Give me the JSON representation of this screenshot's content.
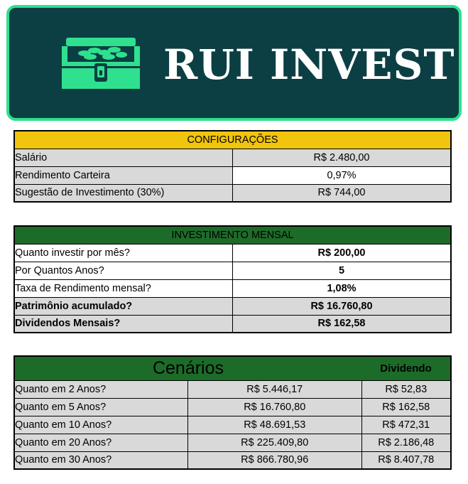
{
  "banner": {
    "title": "RUI INVEST",
    "logo_icon": "treasure-chest-icon",
    "background": "#0c3f43",
    "border_color": "#2fe08e",
    "logo_color": "#2fe08e"
  },
  "config": {
    "title": "CONFIGURAÇÕES",
    "header_color": "#f1c40e",
    "rows": [
      {
        "label": "Salário",
        "value": "R$ 2.480,00"
      },
      {
        "label": "Rendimento Carteira",
        "value": "0,97%"
      },
      {
        "label": "Sugestão de Investimento (30%)",
        "value": "R$ 744,00"
      }
    ]
  },
  "invest": {
    "title": "INVESTIMENTO MENSAL",
    "header_color": "#1d6b29",
    "rows": [
      {
        "label": "Quanto investir por mês?",
        "value": "R$ 200,00"
      },
      {
        "label": "Por Quantos Anos?",
        "value": "5"
      },
      {
        "label": "Taxa de Rendimento mensal?",
        "value": "1,08%"
      },
      {
        "label": "Patrimônio acumulado?",
        "value": "R$ 16.760,80"
      },
      {
        "label": "Dividendos Mensais?",
        "value": "R$ 162,58"
      }
    ]
  },
  "cenarios": {
    "title": "Cenários",
    "dividend_header": "Dividendo",
    "rows": [
      {
        "label": "Quanto em 2 Anos?",
        "value": "R$ 5.446,17",
        "dividend": "R$ 52,83"
      },
      {
        "label": "Quanto em 5 Anos?",
        "value": "R$ 16.760,80",
        "dividend": "R$ 162,58"
      },
      {
        "label": "Quanto em 10 Anos?",
        "value": "R$ 48.691,53",
        "dividend": "R$ 472,31"
      },
      {
        "label": "Quanto em 20 Anos?",
        "value": "R$ 225.409,80",
        "dividend": "R$ 2.186,48"
      },
      {
        "label": "Quanto em 30 Anos?",
        "value": "R$ 866.780,96",
        "dividend": "R$ 8.407,78"
      }
    ]
  }
}
